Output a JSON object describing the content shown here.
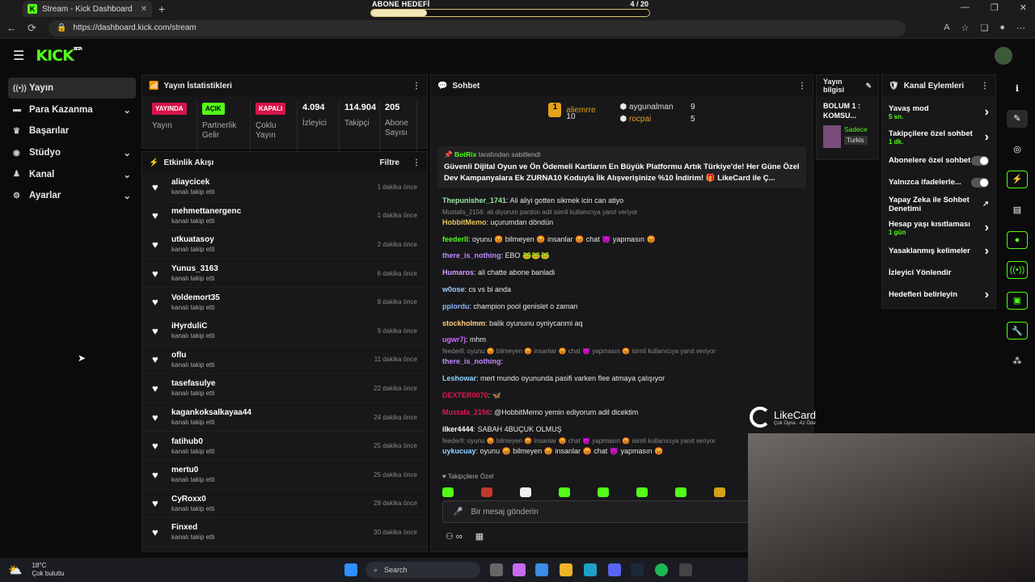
{
  "browser": {
    "tab_title": "Stream - Kick Dashboard",
    "url": "https://dashboard.kick.com/stream"
  },
  "goal": {
    "label": "ABONE HEDEFİ",
    "count": "4 / 20",
    "progress": 0.2
  },
  "app": {
    "logo": "KICK",
    "beta": "BETA"
  },
  "sidebar": {
    "items": [
      {
        "label": "Yayın",
        "icon": "broadcast-icon",
        "chevron": false
      },
      {
        "label": "Para Kazanma",
        "icon": "money-icon",
        "chevron": true
      },
      {
        "label": "Başarılar",
        "icon": "trophy-icon",
        "chevron": false
      },
      {
        "label": "Stüdyo",
        "icon": "studio-icon",
        "chevron": true
      },
      {
        "label": "Kanal",
        "icon": "channel-icon",
        "chevron": true
      },
      {
        "label": "Ayarlar",
        "icon": "gear-icon",
        "chevron": true
      }
    ]
  },
  "stats": {
    "title": "Yayın İstatistikleri",
    "items": [
      {
        "badge": "YAYINDA",
        "badge_color": "#d8134a",
        "label": "Yayın"
      },
      {
        "badge": "AÇIK",
        "badge_color": "#53fc18",
        "label": "Partnerlik Gelir"
      },
      {
        "badge": "KAPALI",
        "badge_color": "#d8134a",
        "label": "Çoklu Yayın"
      },
      {
        "value": "4.094",
        "label": "İzleyici"
      },
      {
        "value": "114.904",
        "label": "Takipçi"
      },
      {
        "value": "205",
        "label": "Abone Sayısı"
      }
    ]
  },
  "activity": {
    "title": "Etkinlik Akışı",
    "filter": "Filtre",
    "items": [
      {
        "name": "aliaycicek",
        "sub": "kanalı takip etti",
        "time": "1 dakika önce"
      },
      {
        "name": "mehmettanergenc",
        "sub": "kanalı takip etti",
        "time": "1 dakika önce"
      },
      {
        "name": "utkuatasoy",
        "sub": "kanalı takip etti",
        "time": "2 dakika önce"
      },
      {
        "name": "Yunus_3163",
        "sub": "kanalı takip etti",
        "time": "6 dakika önce"
      },
      {
        "name": "Voldemort35",
        "sub": "kanalı takip etti",
        "time": "8 dakika önce"
      },
      {
        "name": "iHyrduliC",
        "sub": "kanalı takip etti",
        "time": "9 dakika önce"
      },
      {
        "name": "oflu",
        "sub": "kanalı takip etti",
        "time": "11 dakika önce"
      },
      {
        "name": "tasefasulye",
        "sub": "kanalı takip etti",
        "time": "22 dakika önce"
      },
      {
        "name": "kagankoksalkayaa44",
        "sub": "kanalı takip etti",
        "time": "24 dakika önce"
      },
      {
        "name": "fatihub0",
        "sub": "kanalı takip etti",
        "time": "25 dakika önce"
      },
      {
        "name": "mertu0",
        "sub": "kanalı takip etti",
        "time": "25 dakika önce"
      },
      {
        "name": "CyRoxx0",
        "sub": "kanalı takip etti",
        "time": "28 dakika önce"
      },
      {
        "name": "Finxed",
        "sub": "kanalı takip etti",
        "time": "30 dakika önce"
      }
    ]
  },
  "chat": {
    "title": "Sohbet",
    "leaders": [
      {
        "rank": "1",
        "name": "aliemrre",
        "count": "10"
      },
      {
        "name": "aygunalman",
        "count": "9"
      },
      {
        "name": "rocpai",
        "count": "5"
      }
    ],
    "pinned": {
      "user": "BotRix",
      "by": "tarafından sabitlendi",
      "text": "Güvenli Dijital Oyun ve Ön Ödemeli Kartların En Büyük Platformu Artık Türkiye'de! Her Güne Özel Dev Kampanyalara Ek ZURNA10 Koduyla İlk Alışverişinize %10 İndirim! 🎁 LikeCard ile Ç..."
    },
    "messages": [
      {
        "user": "Thepunisher_1741",
        "color": "#9be7a0",
        "text": "Ali aliyi gotten sikmek icin can atiyo"
      },
      {
        "reply": "Mustafa_2156: ali diyorum pardon adil isimli kullanıcıya yanıt veriyor",
        "user": "HobbitMemo",
        "color": "#e4c65a",
        "text": "uçurumdan döndün"
      },
      {
        "user": "feederll",
        "color": "#53fc18",
        "text": "oyunu 😡 bilmeyen 😡 insanlar 😡 chat 😈 yapmasın 😡"
      },
      {
        "user": "there_is_nothing",
        "color": "#c089ff",
        "text": "EBO 🐸🐸🐸"
      },
      {
        "user": "Humaros",
        "color": "#d79cff",
        "text": "ali chatte abone banladi"
      },
      {
        "user": "w0ose",
        "color": "#9bd0ff",
        "text": "cs vs bi anda"
      },
      {
        "user": "pplordu",
        "color": "#8fb3ff",
        "text": "champion pool genislet o zaman"
      },
      {
        "user": "stockholmm",
        "color": "#ffd27a",
        "text": "balik oyununu oyniycanmi aq"
      },
      {
        "user": "ugwr7j",
        "color": "#d06aff",
        "text": "mhm"
      },
      {
        "reply": "feederll: oyunu 😡 bilmeyen 😡 insanlar 😡 chat 😈 yapmasın 😡 isimli kullanıcıya yanıt veriyor",
        "user": "there_is_nothing",
        "color": "#c089ff",
        "text": ""
      },
      {
        "user": "Leshowar",
        "color": "#8fd3ff",
        "text": "mert mundo oyununda pasifi varken flee atmaya çalışıyor"
      },
      {
        "user": "DEXTER0070",
        "color": "#e0194f",
        "text": "🦋"
      },
      {
        "user": "Mustafa_2156",
        "color": "#e0194f",
        "text": "@HobbitMemo yemin ediyorum adil dicektim"
      },
      {
        "user": "ilker4444",
        "color": "#ffffff",
        "text": "SABAH 4BUÇUK OLMUŞ"
      },
      {
        "reply": "feederll: oyunu 😡 bilmeyen 😡 insanlar 😡 chat 😈 yapmasın 😡 isimli kullanıcıya yanıt veriyor",
        "user": "uykucuay",
        "color": "#8fd3ff",
        "text": "oyunu 😡 bilmeyen 😡 insanlar 😡 chat 😈 yapmasın 😡"
      }
    ],
    "followers_label": "Takipçilere Özel",
    "input_placeholder": "Bir mesaj gönderin"
  },
  "stream_info": {
    "title": "Yayın bilgisi",
    "name": "BOLUM 1 : KOMSU...",
    "tag1": "Sadece",
    "tag2": "Turkis"
  },
  "actions": {
    "title": "Kanal Eylemleri",
    "items": [
      {
        "label": "Yavaş mod",
        "sub": "5 sn.",
        "control": "arrow"
      },
      {
        "label": "Takipçilere özel sohbet",
        "sub": "1 dk.",
        "control": "arrow"
      },
      {
        "label": "Abonelere özel sohbet",
        "control": "toggle"
      },
      {
        "label": "Yalnızca ifadelerle...",
        "control": "toggle"
      },
      {
        "label": "Yapay Zeka ile Sohbet Denetimi",
        "control": "external"
      },
      {
        "label": "Hesap yaşı kısıtlaması",
        "sub": "1 gün",
        "control": "arrow"
      },
      {
        "label": "Yasaklanmış kelimeler",
        "control": "arrow"
      },
      {
        "label": "İzleyici Yönlendir",
        "control": "none"
      },
      {
        "label": "Hedefleri belirleyin",
        "control": "arrow"
      }
    ]
  },
  "overlay": {
    "brand": "LikeCard",
    "tagline": "Çok Oyna · Az Öde"
  },
  "taskbar": {
    "temp": "18°C",
    "weather": "Çok bulutlu",
    "search": "Search"
  }
}
